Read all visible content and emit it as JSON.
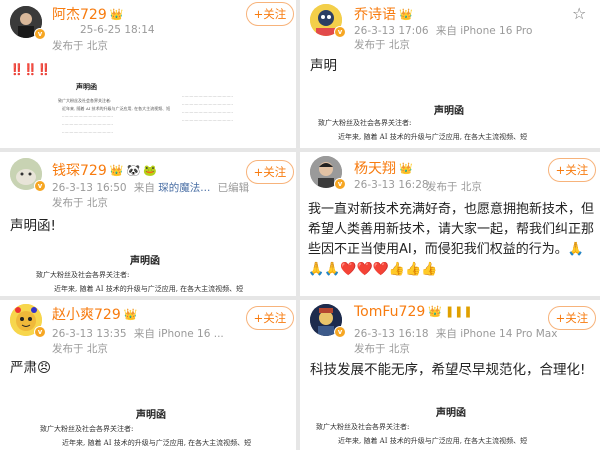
{
  "follow_label": "+关注",
  "posts": [
    {
      "name": "阿杰729",
      "time": "25-6-25 18:14",
      "location": "发布于 北京",
      "content": "‼️‼️‼️"
    },
    {
      "name": "乔诗语",
      "time": "26-3-13 17:06",
      "source": "来自 iPhone 16 Pro",
      "location": "发布于 北京",
      "content": "声明"
    },
    {
      "name": "钱琛729",
      "time": "26-3-13 16:50",
      "source_prefix": "来自",
      "source": "琛的魔法...",
      "edited": "已编辑",
      "location": "发布于 北京",
      "content": "声明函!"
    },
    {
      "name": "杨天翔",
      "time": "26-3-13 16:28",
      "location": "发布于 北京",
      "content": "我一直对新技术充满好奇，也愿意拥抱新技术，但希望人类善用新技术，请大家一起，帮我们纠正那些因不正当使用AI，而侵犯我们权益的行为。🙏🙏🙏❤️❤️❤️👍👍👍"
    },
    {
      "name": "赵小爽729",
      "time": "26-3-13 13:35",
      "source": "来自 iPhone 16 ...",
      "location": "发布于 北京",
      "content": "严肃😠"
    },
    {
      "name": "TomFu729",
      "time": "26-3-13 16:18",
      "source": "来自 iPhone 14 Pro Max",
      "location": "发布于 北京",
      "content": "科技发展不能无序，希望尽早规范化，合理化!"
    }
  ],
  "document": {
    "title": "声明函",
    "salutation": "致广大粉丝及社会各界关注者:",
    "body": "近年来, 随着 AI 技术的升级与广泛应用, 在各大主流视频、短"
  },
  "colors": {
    "name_orange": "#f77b0f",
    "follow_border": "#f7b37b",
    "meta_gray": "#9a9a9a",
    "source_blue": "#4a6fa5"
  }
}
